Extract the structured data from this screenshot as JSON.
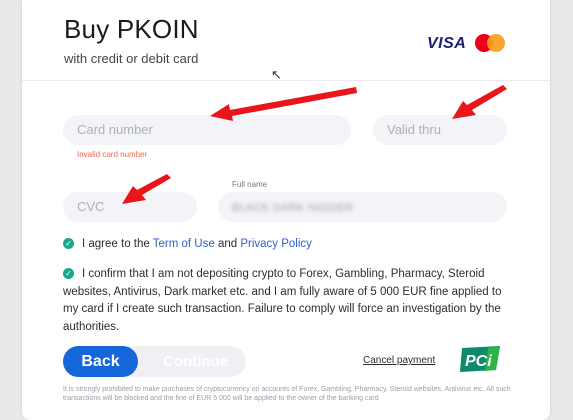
{
  "header": {
    "title": "Buy PKOIN",
    "subtitle": "with credit or debit card",
    "visa_text": "VISA",
    "mastercard_icon": "mastercard-logo"
  },
  "form": {
    "card_number_placeholder": "Card number",
    "card_number_error": "Invalid card number",
    "valid_thru_placeholder": "Valid thru",
    "cvc_placeholder": "CVC",
    "full_name_label": "Full name",
    "full_name_value": "BLACK DARK NIGGER"
  },
  "agreements": {
    "terms_prefix": "I agree to the ",
    "terms_link": "Term of Use",
    "terms_and": " and ",
    "privacy_link": "Privacy Policy",
    "confirm_text": "I confirm that I am not depositing crypto to Forex, Gambling, Pharmacy, Steroid websites, Antivirus, Dark market etc. and I am fully aware of 5 000 EUR fine applied to my card if I create such transaction. Failure to comply will force an investigation by the authorities."
  },
  "actions": {
    "back_label": "Back",
    "continue_label": "Continue",
    "cancel_label": "Cancel payment",
    "pci_text": "PCi"
  },
  "footnote": "It is strongly prohibited to make purchases of cryptocurrency on accounts of Forex, Gambling, Pharmacy, Steroid websites, Antivirus etc. All such transactions will be blocked and the fine of EUR 5 000 will be applied to the owner of the banking card",
  "colors": {
    "primary": "#1566d8",
    "check": "#1aa78c",
    "error": "#ef6a4d",
    "annotation_arrow": "#e8151b"
  }
}
